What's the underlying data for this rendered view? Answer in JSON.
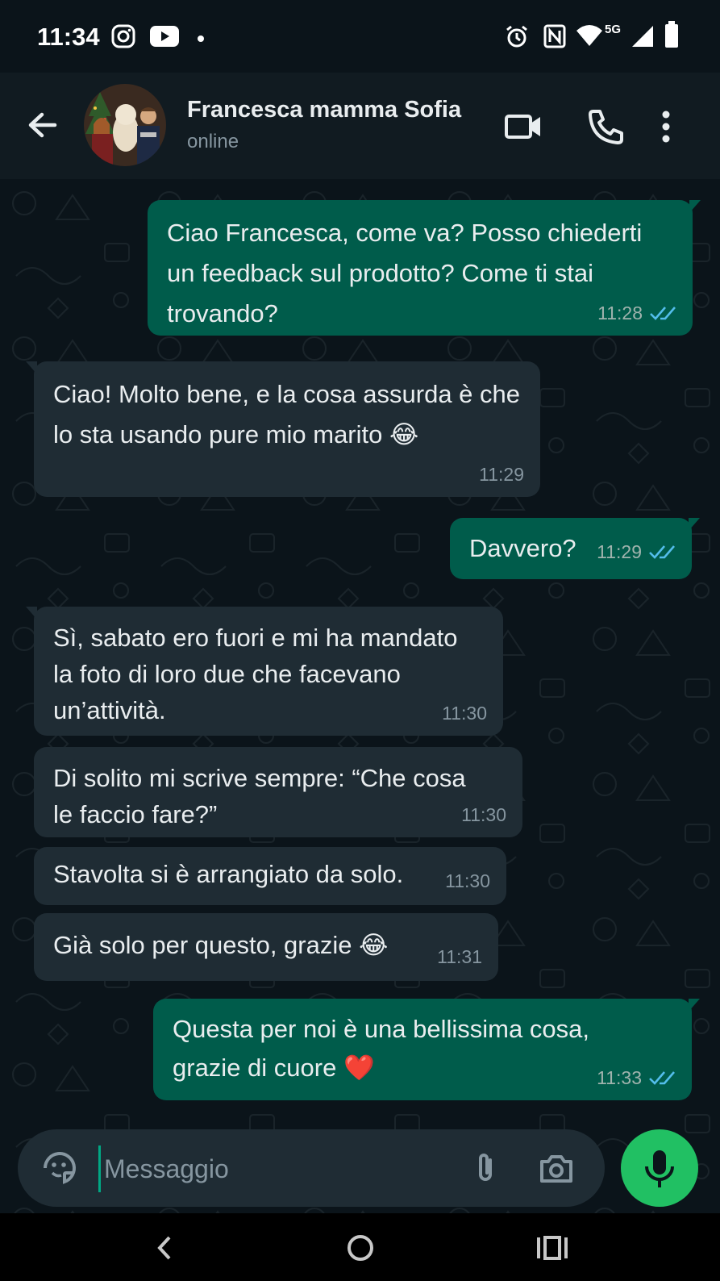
{
  "status_bar": {
    "time": "11:34",
    "network": "5G",
    "left_icons": [
      "instagram-icon",
      "youtube-icon",
      "dot-icon"
    ],
    "right_icons": [
      "alarm-icon",
      "nfc-icon",
      "wifi-icon",
      "signal-icon",
      "battery-icon"
    ]
  },
  "header": {
    "contact_name": "Francesca mamma Sofia",
    "status": "online",
    "icons": [
      "back-arrow-icon",
      "video-call-icon",
      "phone-call-icon",
      "more-vert-icon"
    ]
  },
  "messages": [
    {
      "direction": "out",
      "text": "Ciao Francesca, come va? Posso chiederti un feedback sul prodotto? Come ti stai trovando?",
      "time": "11:28",
      "read": true
    },
    {
      "direction": "in",
      "text": "Ciao! Molto bene, e la cosa assurda è che lo sta usando pure mio marito 😂",
      "time": "11:29"
    },
    {
      "direction": "out",
      "text": "Davvero?",
      "time": "11:29",
      "read": true
    },
    {
      "direction": "in",
      "text": "Sì, sabato ero fuori e mi ha mandato la foto di loro due che facevano un’attività.",
      "time": "11:30"
    },
    {
      "direction": "in",
      "text": "Di solito mi scrive sempre: “Che cosa le faccio fare?”",
      "time": "11:30"
    },
    {
      "direction": "in",
      "text": "Stavolta si è arrangiato da solo.",
      "time": "11:30"
    },
    {
      "direction": "in",
      "text": "Già solo per questo, grazie 😂",
      "time": "11:31"
    },
    {
      "direction": "out",
      "text": "Questa per noi è una bellissima cosa, grazie di cuore ❤️",
      "time": "11:33",
      "read": true
    }
  ],
  "composer": {
    "placeholder": "Messaggio",
    "icons": [
      "sticker-icon",
      "attach-icon",
      "camera-icon",
      "mic-icon"
    ]
  },
  "colors": {
    "background": "#0b141a",
    "header": "#111b21",
    "outgoing_bubble": "#005c4b",
    "incoming_bubble": "#1f2c34",
    "read_ticks": "#53bdeb",
    "mic_button": "#21c063"
  }
}
